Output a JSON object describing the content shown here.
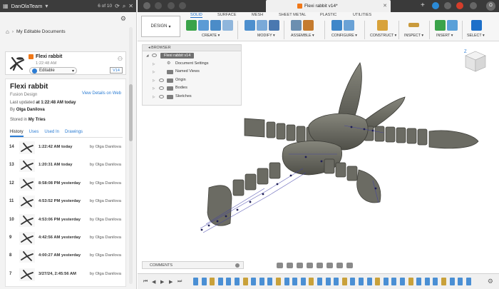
{
  "app": {
    "team_name": "DanOlaTeam",
    "doc_counter": "6 of 10",
    "tab_title": "Flexi rabbit v14*"
  },
  "left_panel": {
    "breadcrumb": "My Editable Documents",
    "card": {
      "title": "Flexi rabbit",
      "time": "1:22:48 AM",
      "status": "Editable",
      "version": "V14"
    },
    "details": {
      "title": "Flexi rabbit",
      "type": "Fusion Design",
      "view_link": "View Details on Web",
      "updated_prefix": "Last updated",
      "updated_value": "at 1:22:48 AM today",
      "by_prefix": "By",
      "by_value": "Olga Danilova",
      "stored_prefix": "Stored in",
      "stored_value": "My Tries"
    },
    "tabs": [
      "History",
      "Uses",
      "Used In",
      "Drawings"
    ],
    "history": [
      {
        "num": "14",
        "time": "1:22:42 AM today",
        "by": "by Olga Danilova"
      },
      {
        "num": "13",
        "time": "1:20:31 AM today",
        "by": "by Olga Danilova"
      },
      {
        "num": "12",
        "time": "8:58:08 PM yesterday",
        "by": "by Olga Danilova"
      },
      {
        "num": "11",
        "time": "4:53:52 PM yesterday",
        "by": "by Olga Danilova"
      },
      {
        "num": "10",
        "time": "4:53:06 PM yesterday",
        "by": "by Olga Danilova"
      },
      {
        "num": "9",
        "time": "4:42:56 AM yesterday",
        "by": "by Olga Danilova"
      },
      {
        "num": "8",
        "time": "4:00:27 AM yesterday",
        "by": "by Olga Danilova"
      },
      {
        "num": "7",
        "time": "3/27/24, 2:45:56 AM",
        "by": "by Olga Danilova"
      }
    ]
  },
  "toolbar": {
    "design_label": "DESIGN",
    "tabs": [
      "SOLID",
      "SURFACE",
      "MESH",
      "SHEET METAL",
      "PLASTIC",
      "UTILITIES"
    ],
    "groups": [
      "CREATE",
      "MODIFY",
      "ASSEMBLE",
      "CONFIGURE",
      "CONSTRUCT",
      "INSPECT",
      "INSERT",
      "SELECT"
    ]
  },
  "browser": {
    "header": "BROWSER",
    "root": "Flexi rabbit v14",
    "items": [
      "Document Settings",
      "Named Views",
      "Origin",
      "Bodies",
      "Sketches"
    ]
  },
  "viewcube": {
    "label": "Z"
  },
  "comments": {
    "label": "COMMENTS"
  },
  "colors": {
    "accent": "#1d6fc9",
    "fusion_orange": "#f07818",
    "model_gray": "#6e6e66"
  }
}
